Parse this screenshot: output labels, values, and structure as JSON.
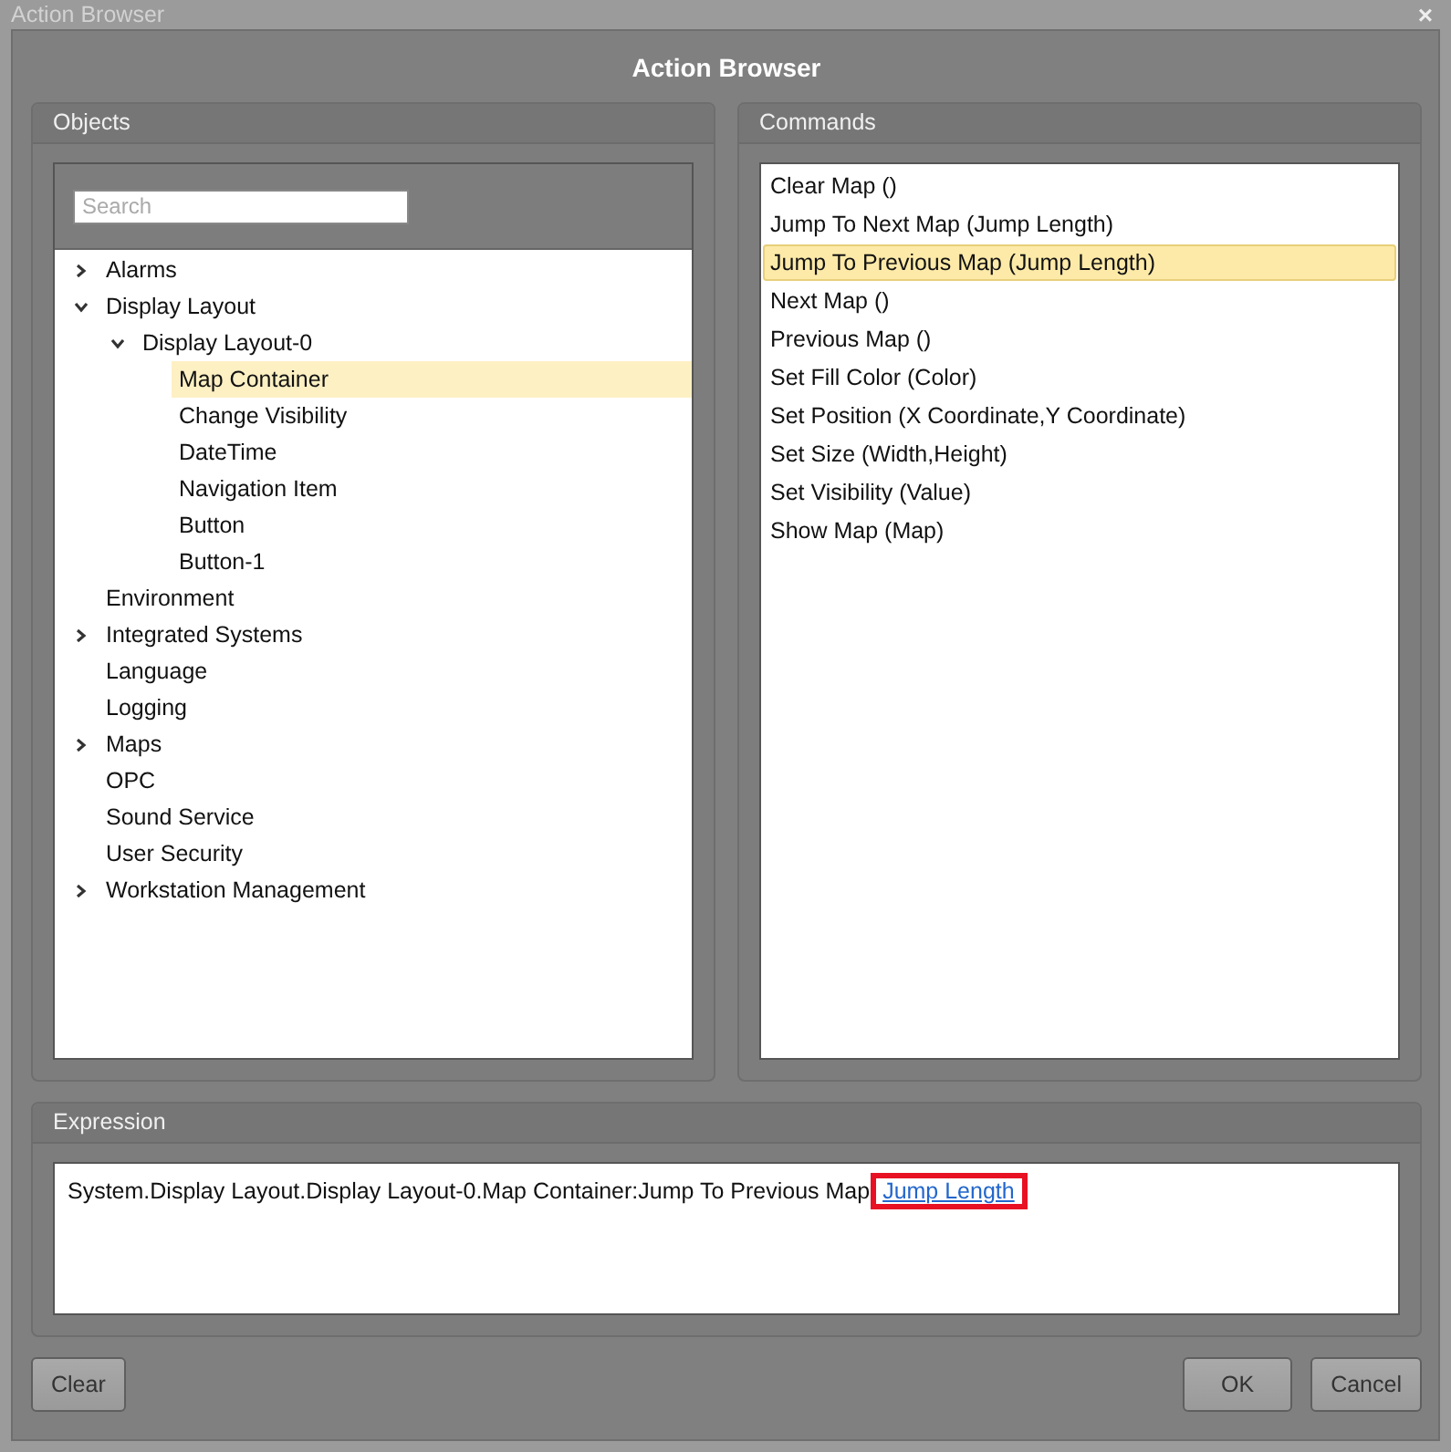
{
  "window": {
    "title": "Action Browser",
    "heading": "Action Browser",
    "close": "×"
  },
  "objects": {
    "title": "Objects",
    "search": {
      "placeholder": "Search"
    },
    "tree": [
      {
        "label": "Alarms",
        "expanded": false,
        "selected": false
      },
      {
        "label": "Display Layout",
        "expanded": true,
        "selected": false,
        "children": [
          {
            "label": "Display Layout-0",
            "expanded": true,
            "selected": false,
            "children": [
              {
                "label": "Map Container",
                "selected": true
              },
              {
                "label": "Change Visibility",
                "selected": false
              },
              {
                "label": "DateTime",
                "selected": false
              },
              {
                "label": "Navigation Item",
                "selected": false
              },
              {
                "label": "Button",
                "selected": false
              },
              {
                "label": "Button-1",
                "selected": false
              }
            ]
          }
        ]
      },
      {
        "label": "Environment",
        "selected": false
      },
      {
        "label": "Integrated Systems",
        "expanded": false,
        "selected": false
      },
      {
        "label": "Language",
        "selected": false
      },
      {
        "label": "Logging",
        "selected": false
      },
      {
        "label": "Maps",
        "expanded": false,
        "selected": false
      },
      {
        "label": "OPC",
        "selected": false
      },
      {
        "label": "Sound Service",
        "selected": false
      },
      {
        "label": "User Security",
        "selected": false
      },
      {
        "label": "Workstation Management",
        "expanded": false,
        "selected": false
      }
    ]
  },
  "commands": {
    "title": "Commands",
    "items": [
      {
        "label": "Clear Map ()",
        "selected": false
      },
      {
        "label": "Jump To Next Map (Jump Length)",
        "selected": false
      },
      {
        "label": "Jump To Previous Map (Jump Length)",
        "selected": true
      },
      {
        "label": "Next Map ()",
        "selected": false
      },
      {
        "label": "Previous Map ()",
        "selected": false
      },
      {
        "label": "Set Fill Color (Color)",
        "selected": false
      },
      {
        "label": "Set Position (X Coordinate,Y Coordinate)",
        "selected": false
      },
      {
        "label": "Set Size (Width,Height)",
        "selected": false
      },
      {
        "label": "Set Visibility (Value)",
        "selected": false
      },
      {
        "label": "Show Map (Map)",
        "selected": false
      }
    ]
  },
  "expression": {
    "title": "Expression",
    "text": "System.Display Layout.Display Layout-0.Map Container:Jump To Previous Map",
    "link": "Jump Length",
    "link_highlighted": true
  },
  "buttons": [
    {
      "label": "Clear",
      "kind": "left"
    },
    {
      "label": "OK",
      "kind": "right"
    },
    {
      "label": "Cancel",
      "kind": "right"
    }
  ]
}
